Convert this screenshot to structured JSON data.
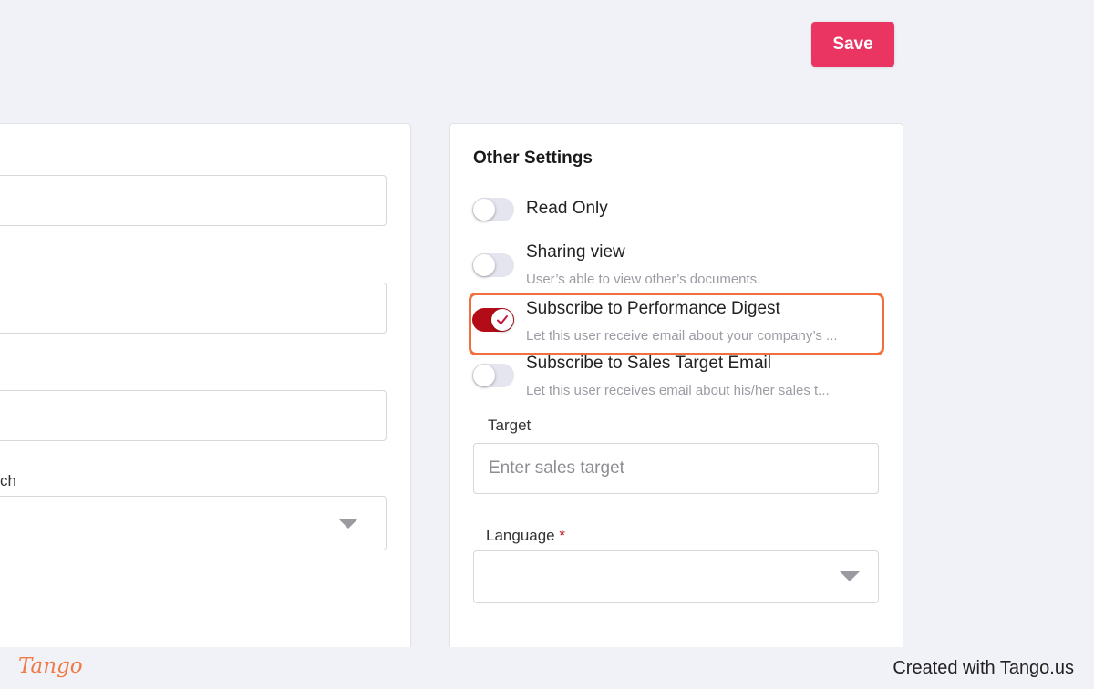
{
  "toolbar": {
    "save_label": "Save"
  },
  "left_panel": {
    "field_label_partial": "ch"
  },
  "other_settings": {
    "title": "Other Settings",
    "options": [
      {
        "label": "Read Only",
        "description": "",
        "enabled": false
      },
      {
        "label": "Sharing view",
        "description": "User’s able to view other’s documents.",
        "enabled": false
      },
      {
        "label": "Subscribe to Performance Digest",
        "description": "Let this user receive email about your company’s ...",
        "enabled": true
      },
      {
        "label": "Subscribe to Sales Target Email",
        "description": "Let this user receives email about his/her sales t...",
        "enabled": false
      }
    ],
    "target": {
      "label": "Target",
      "placeholder": "Enter sales target"
    },
    "language": {
      "label": "Language",
      "required_mark": "*",
      "value": ""
    }
  },
  "footer": {
    "logo_text": "Tango",
    "credit": "Created with Tango.us"
  },
  "colors": {
    "accent": "#ea3461",
    "toggle_on": "#b30c16",
    "highlight": "#f06f3d"
  }
}
